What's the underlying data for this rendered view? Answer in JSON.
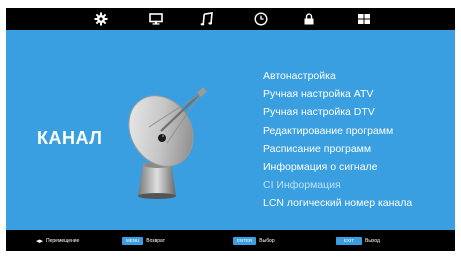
{
  "colors": {
    "panel_bg": "#3a9fe0",
    "bar_bg": "#000000",
    "text": "#ffffff",
    "disabled_text": "#bde0f6"
  },
  "top_tabs": [
    {
      "icon": "gear-icon"
    },
    {
      "icon": "monitor-icon"
    },
    {
      "icon": "music-note-icon"
    },
    {
      "icon": "clock-icon"
    },
    {
      "icon": "lock-icon"
    },
    {
      "icon": "windows-grid-icon"
    }
  ],
  "page_title": "КАНАЛ",
  "menu_items": [
    {
      "label": "Автонастройка",
      "disabled": false
    },
    {
      "label": "Ручная настройка ATV",
      "disabled": false
    },
    {
      "label": "Ручная настройка DTV",
      "disabled": false
    },
    {
      "label": "Редактирование программ",
      "disabled": false
    },
    {
      "label": "Расписание программ",
      "disabled": false
    },
    {
      "label": "Информация о сигнале",
      "disabled": false
    },
    {
      "label": "CI Информация",
      "disabled": true
    },
    {
      "label": "LCN логический номер канала",
      "disabled": false
    }
  ],
  "footer": {
    "move_label": "Перемещение",
    "menu_key": "MENU",
    "back_label": "Возврат",
    "enter_key": "ENTER",
    "select_label": "Выбор",
    "exit_key": "EXIT",
    "exit_label": "Выход"
  }
}
